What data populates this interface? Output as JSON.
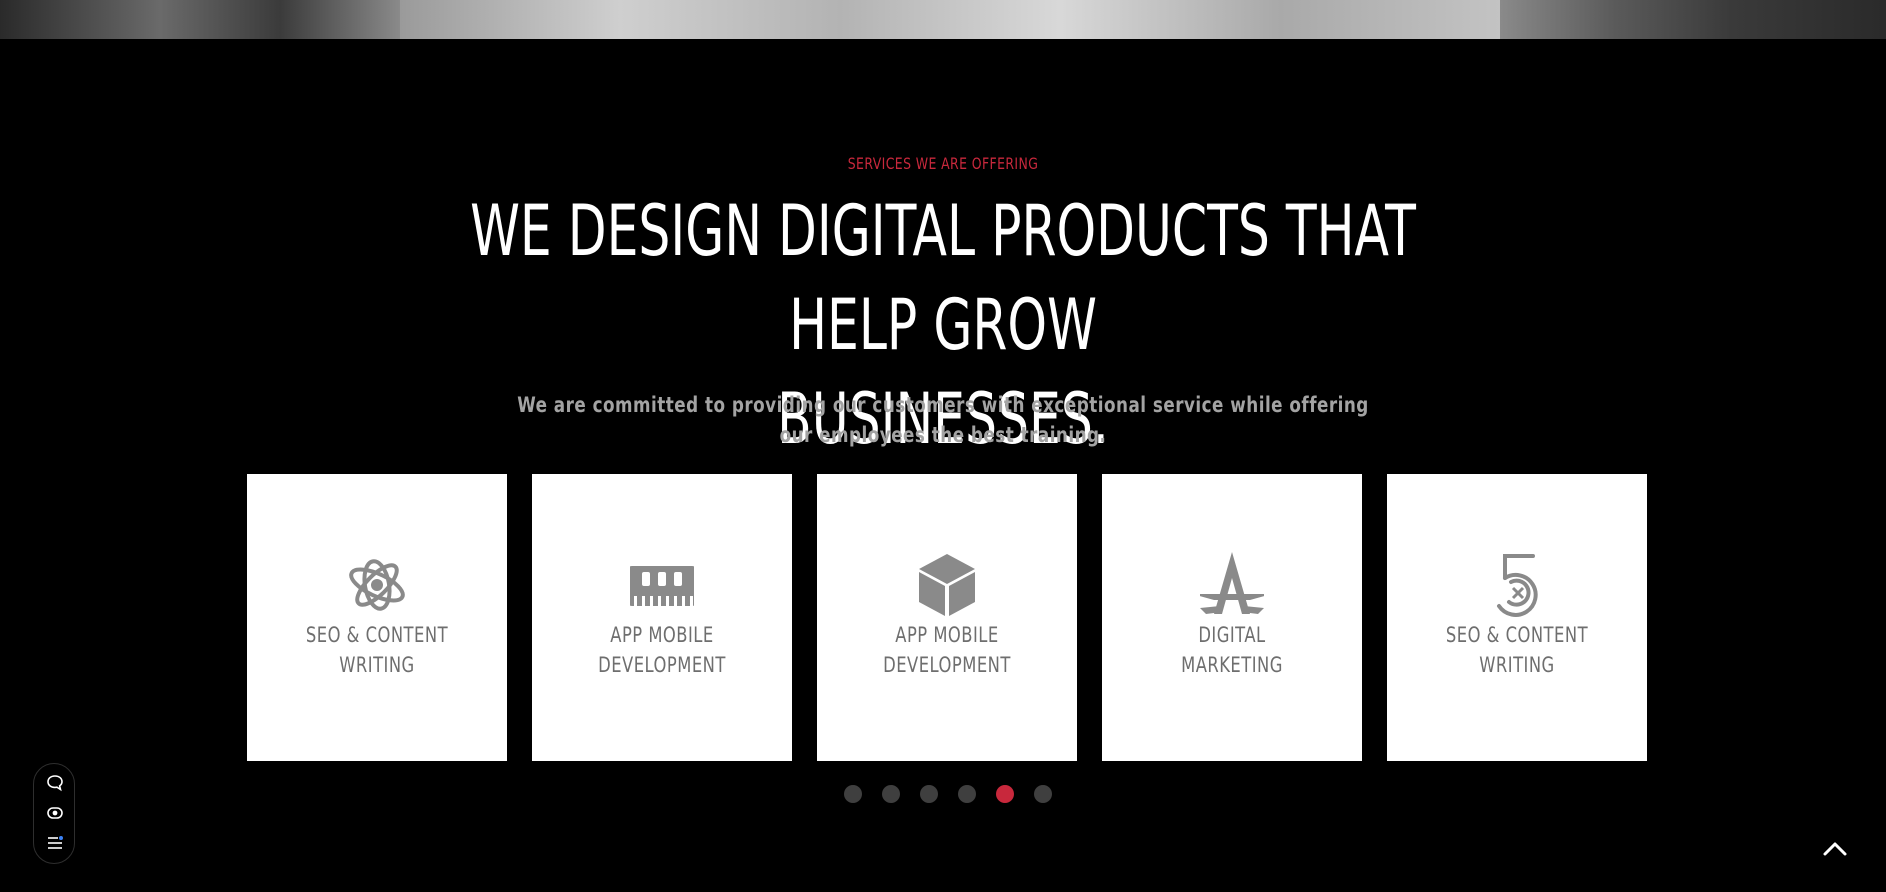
{
  "page": {
    "eyebrow": "SERVICES WE ARE OFFERING",
    "headline_line1": "WE DESIGN DIGITAL PRODUCTS THAT HELP GROW",
    "headline_line2": "BUSINESSES.",
    "subtext_line1": "We are committed to providing our customers with exceptional service while offering",
    "subtext_line2": "our employees the best training."
  },
  "services": [
    {
      "line1": "SEO & CONTENT",
      "line2": "WRITING",
      "icon": "atom-orbit-icon"
    },
    {
      "line1": "APP MOBILE",
      "line2": "DEVELOPMENT",
      "icon": "memory-chip-icon"
    },
    {
      "line1": "APP MOBILE",
      "line2": "DEVELOPMENT",
      "icon": "cube-icon"
    },
    {
      "line1": "DIGITAL",
      "line2": "MARKETING",
      "icon": "letter-a-icon"
    },
    {
      "line1": "SEO & CONTENT",
      "line2": "WRITING",
      "icon": "number-five-icon"
    }
  ],
  "carousel": {
    "dot_count": 6,
    "active_index": 4
  },
  "side_widget": {
    "icons": [
      "chat-bubble-icon",
      "eye-icon",
      "menu-list-icon"
    ]
  },
  "scroll_top": {
    "icon": "chevron-up-icon"
  },
  "colors": {
    "accent": "#c8283c",
    "background": "#000000",
    "card": "#ffffff",
    "icon_gray": "#8a8a8a",
    "dot_inactive": "#3f3f3f"
  }
}
